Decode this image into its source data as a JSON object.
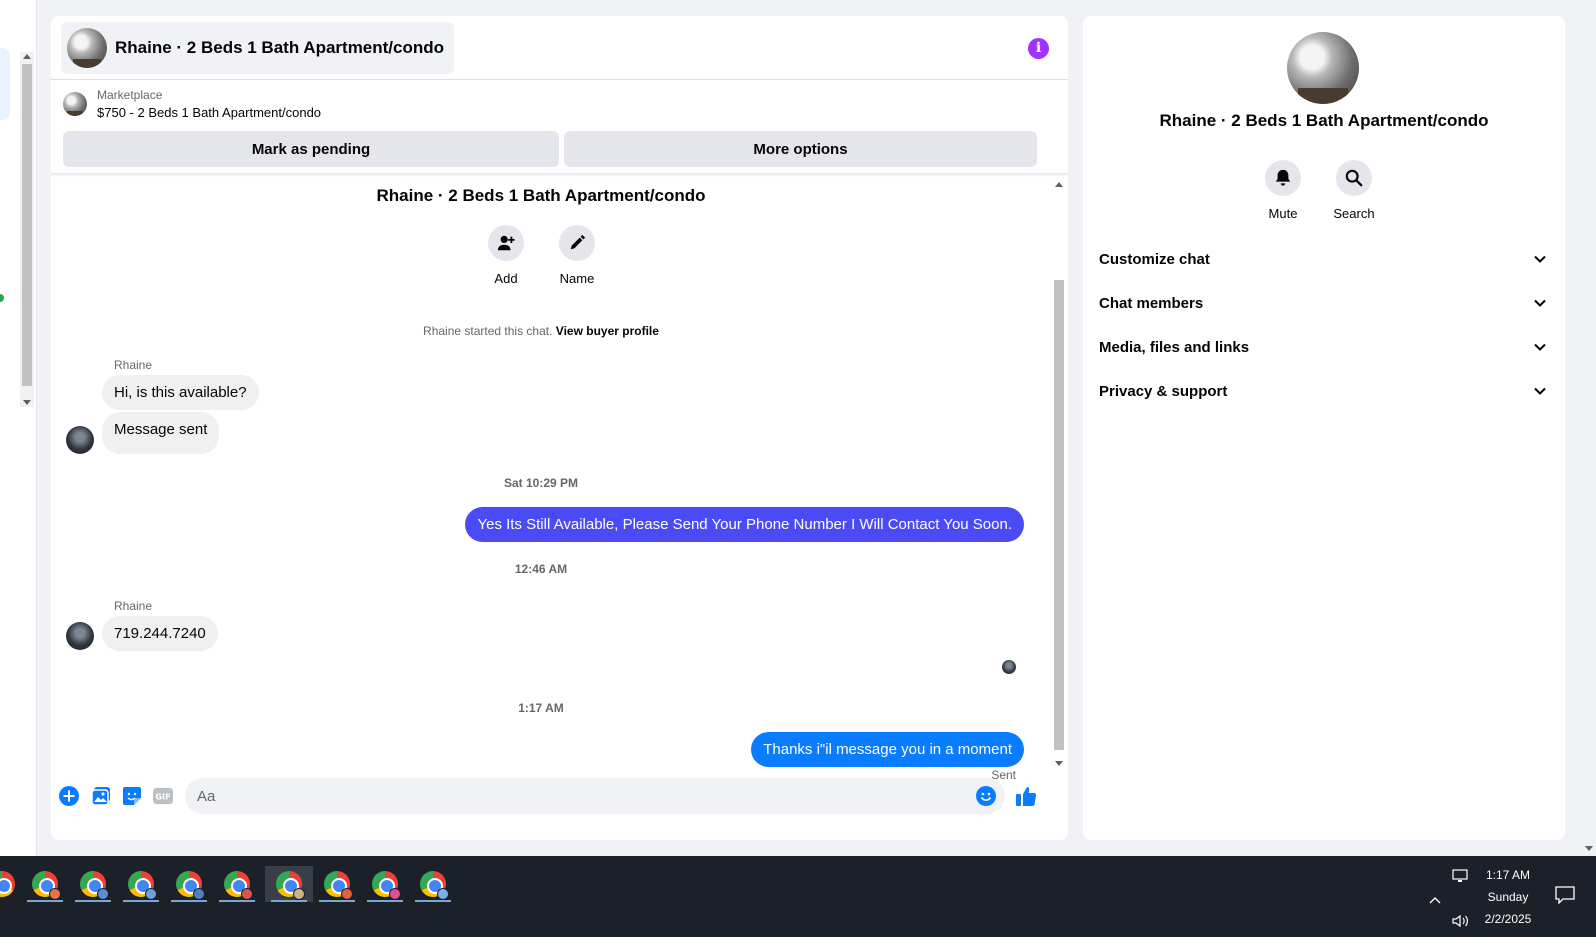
{
  "conversation": {
    "title": "Rhaine · 2 Beds 1 Bath Apartment/condo"
  },
  "listing": {
    "source_label": "Marketplace",
    "price_line": "$750 - 2 Beds 1 Bath Apartment/condo"
  },
  "actions": {
    "mark_pending": "Mark as pending",
    "more_options": "More options"
  },
  "thread": {
    "group_title": "Rhaine · 2 Beds 1 Bath Apartment/condo",
    "add_label": "Add",
    "name_label": "Name",
    "started_text": "Rhaine started this chat.",
    "view_profile_link": "View buyer profile",
    "messages": [
      {
        "sender": "Rhaine",
        "text": "Hi, is this available?"
      },
      {
        "text": "Message sent"
      },
      {
        "timestamp": "Sat 10:29 PM"
      },
      {
        "text": "Yes Its Still Available, Please Send Your Phone Number I Will Contact You Soon.",
        "outgoing": true,
        "color": "#4b4bf6"
      },
      {
        "timestamp": "12:46 AM"
      },
      {
        "sender": "Rhaine",
        "text": "719.244.7240"
      },
      {
        "timestamp": "1:17 AM"
      },
      {
        "text": "Thanks i\"il message you in a moment",
        "outgoing": true,
        "color": "#0a7cff"
      }
    ],
    "status": "Sent"
  },
  "composer": {
    "placeholder": "Aa",
    "icons": [
      "plus-circle-icon",
      "photo-icon",
      "sticker-icon",
      "gif-icon",
      "emoji-icon",
      "thumbs-up-icon"
    ]
  },
  "info_panel": {
    "title": "Rhaine · 2 Beds 1 Bath Apartment/condo",
    "mute_label": "Mute",
    "search_label": "Search",
    "sections": [
      "Customize chat",
      "Chat members",
      "Media, files and links",
      "Privacy & support"
    ]
  },
  "taskbar": {
    "time": "1:17 AM",
    "day": "Sunday",
    "date": "2/2/2025"
  },
  "colors": {
    "accent": "#0a7cff",
    "outgoing_purple": "#4b4bf6",
    "info_icon": "#a033ff"
  }
}
